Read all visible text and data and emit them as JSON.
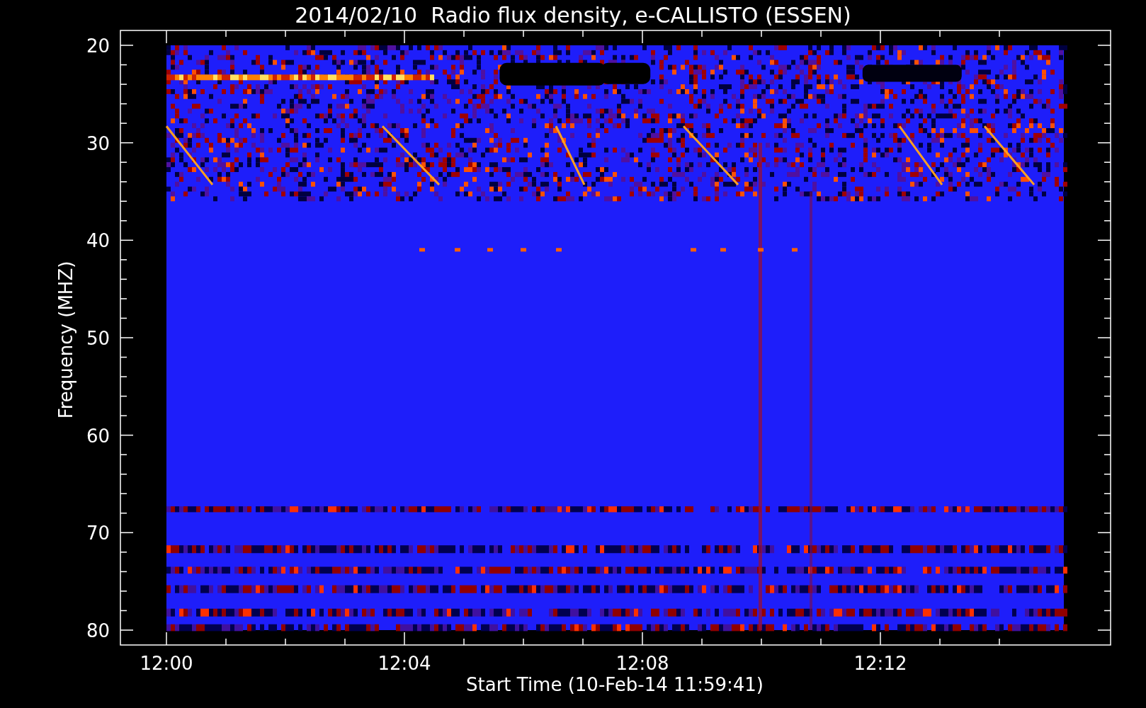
{
  "title": "2014/02/10  Radio flux density, e-CALLISTO (ESSEN)",
  "y_axis": {
    "label": "Frequency (MHZ)",
    "ticks": [
      "20",
      "30",
      "40",
      "50",
      "60",
      "70",
      "80"
    ]
  },
  "x_axis": {
    "label": "Start Time (10-Feb-14 11:59:41)",
    "ticks": [
      "12:00",
      "12:04",
      "12:08",
      "12:12"
    ]
  }
}
